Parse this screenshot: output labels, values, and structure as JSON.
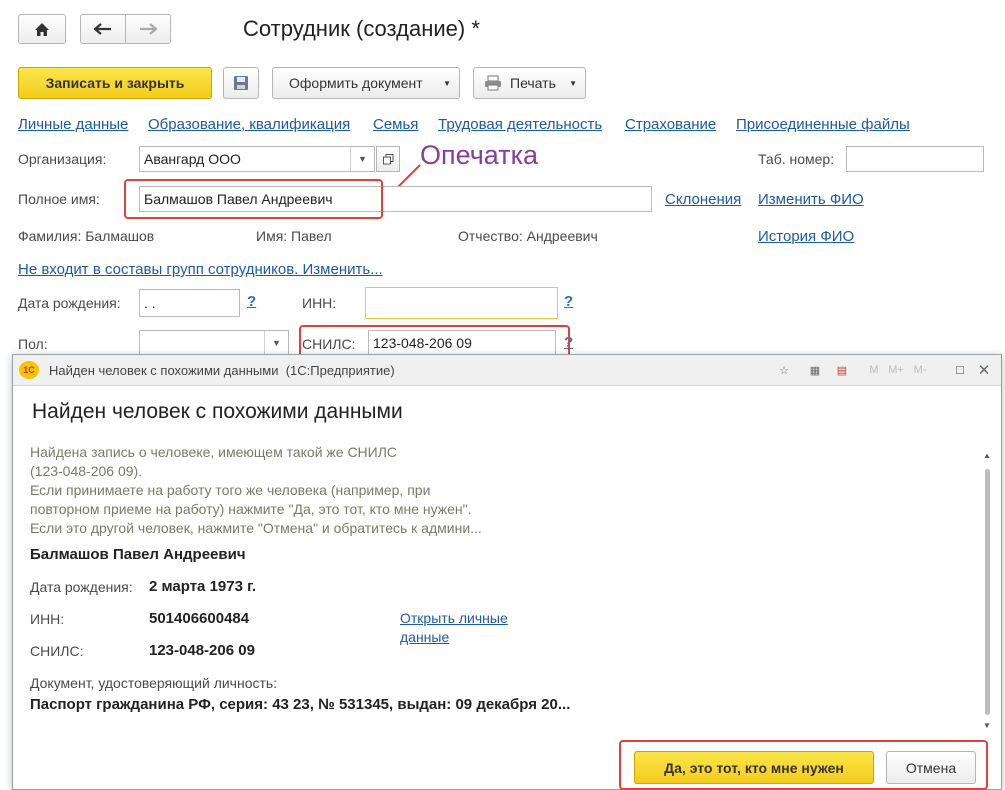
{
  "window": {
    "title": "Сотрудник (создание) *"
  },
  "toolbar": {
    "save_close": "Записать и закрыть",
    "make_document": "Оформить документ",
    "print": "Печать"
  },
  "tabs": [
    "Личные данные",
    "Образование, квалификация",
    "Семья",
    "Трудовая деятельность",
    "Страхование",
    "Присоединенные файлы"
  ],
  "form": {
    "org_label": "Организация:",
    "org_value": "Авангард ООО",
    "tab_num_label": "Таб. номер:",
    "fullname_label": "Полное имя:",
    "fullname_value": "Балмашов Павел Андреевич",
    "declensions_link": "Склонения",
    "change_fio_link": "Изменить ФИО",
    "surname": "Фамилия: Балмашов",
    "name": "Имя: Павел",
    "patronymic": "Отчество: Андреевич",
    "history_fio_link": "История ФИО",
    "groups_link": "Не входит в составы групп сотрудников. Изменить...",
    "birth_label": "Дата рождения:",
    "birth_value": " .  .",
    "inn_label": "ИНН:",
    "inn_value": "",
    "gender_label": "Пол:",
    "snils_label": "СНИЛС:",
    "snils_value": "123-048-206 09",
    "help": "?"
  },
  "annotation": {
    "typo": "Опечатка"
  },
  "dialog": {
    "window_title": "Найден человек с похожими данными  (1С:Предприятие)",
    "heading": "Найден человек с похожими данными",
    "message": [
      "Найдена запись о человеке, имеющем такой же СНИЛС",
      "(123-048-206 09).",
      "Если принимаете на работу того же человека (например, при",
      "повторном приеме на работу) нажмите \"Да, это тот, кто мне нужен\".",
      "Если это другой человек, нажмите \"Отмена\" и обратитесь к админи..."
    ],
    "person_name": "Балмашов Павел Андреевич",
    "birth_label": "Дата рождения:",
    "birth_value": "2 марта 1973 г.",
    "inn_label": "ИНН:",
    "inn_value": "501406600484",
    "snils_label": "СНИЛС:",
    "snils_value": "123-048-206 09",
    "open_personal_line1": "Открыть личные",
    "open_personal_line2": "данные",
    "doc_label": "Документ, удостоверяющий личность:",
    "doc_value": "Паспорт гражданина РФ, серия: 43 23, № 531345, выдан: 09 декабря 20...",
    "yes_button": "Да, это тот, кто мне нужен",
    "cancel_button": "Отмена",
    "icon_1c": "1С"
  },
  "colors": {
    "accent_yellow": "#f3cc1c",
    "link_blue": "#1d5aa5",
    "annotation_red": "#e0413b",
    "annotation_purple": "#8a3c9a"
  }
}
